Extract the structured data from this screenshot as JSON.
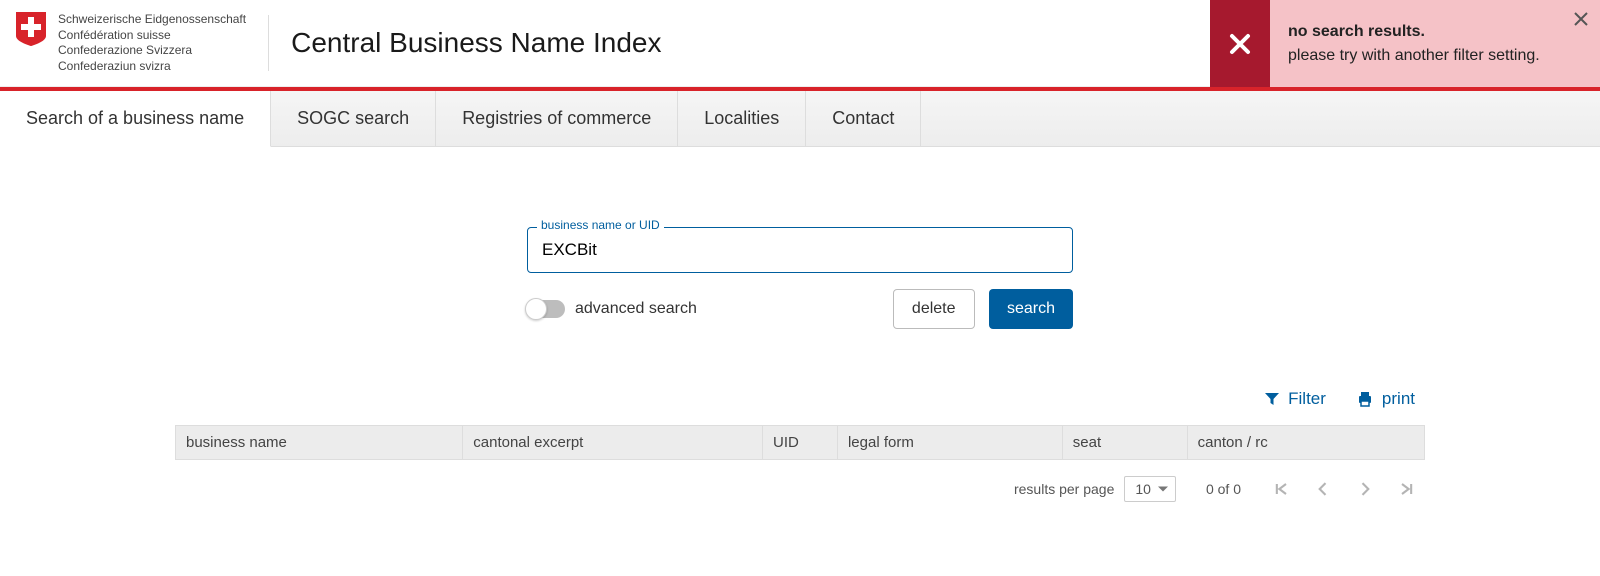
{
  "brand": {
    "lines": [
      "Schweizerische Eidgenossenschaft",
      "Confédération suisse",
      "Confederazione Svizzera",
      "Confederaziun svizra"
    ],
    "site_title": "Central Business Name Index"
  },
  "tabs": [
    {
      "label": "Search of a business name",
      "active": true
    },
    {
      "label": "SOGC search",
      "active": false
    },
    {
      "label": "Registries of commerce",
      "active": false
    },
    {
      "label": "Localities",
      "active": false
    },
    {
      "label": "Contact",
      "active": false
    }
  ],
  "toast": {
    "line1": "no search results.",
    "line2": "please try with another filter setting."
  },
  "search": {
    "field_label": "business name or UID",
    "value": "EXCBit",
    "advanced_label": "advanced search",
    "advanced_on": false,
    "delete_label": "delete",
    "search_label": "search"
  },
  "toolbar": {
    "filter_label": "Filter",
    "print_label": "print"
  },
  "columns": [
    "business name",
    "cantonal excerpt",
    "UID",
    "legal form",
    "seat",
    "canton / rc"
  ],
  "rows": [],
  "paginator": {
    "rpp_label": "results per page",
    "rpp_value": "10",
    "range": "0 of 0"
  }
}
